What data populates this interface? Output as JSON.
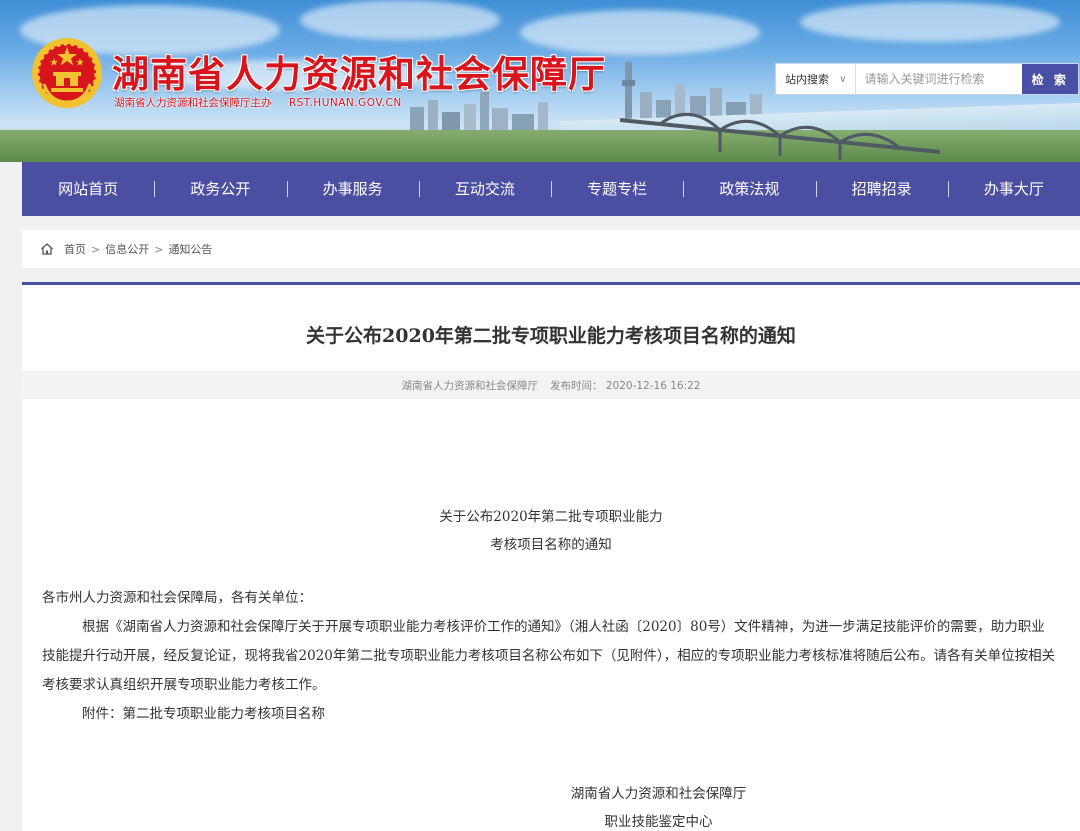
{
  "header": {
    "site_title": "湖南省人力资源和社会保障厅",
    "site_sub": "湖南省人力资源和社会保障厅主办",
    "site_url": "RST.HUNAN.GOV.CN"
  },
  "search": {
    "scope": "站内搜索",
    "placeholder": "请输入关键词进行检索",
    "button": "检 索"
  },
  "nav": {
    "items": [
      "网站首页",
      "政务公开",
      "办事服务",
      "互动交流",
      "专题专栏",
      "政策法规",
      "招聘招录",
      "办事大厅"
    ]
  },
  "breadcrumb": {
    "items": [
      "首页",
      "信息公开",
      "通知公告"
    ]
  },
  "article": {
    "title": "关于公布2020年第二批专项职业能力考核项目名称的通知",
    "source": "湖南省人力资源和社会保障厅",
    "publish_label": "发布时间：",
    "publish_time": "2020-12-16 16:22",
    "doc_title_line1": "关于公布2020年第二批专项职业能力",
    "doc_title_line2": "考核项目名称的通知",
    "salutation": "各市州人力资源和社会保障局，各有关单位：",
    "body": "根据《湖南省人力资源和社会保障厅关于开展专项职业能力考核评价工作的通知》（湘人社函〔2020〕80号）文件精神，为进一步满足技能评价的需要，助力职业技能提升行动开展，经反复论证，现将我省2020年第二批专项职业能力考核项目名称公布如下（见附件），相应的专项职业能力考核标准将随后公布。请各有关单位按相关考核要求认真组织开展专项职业能力考核工作。",
    "attachment": "附件：第二批专项职业能力考核项目名称",
    "signature_line1": "湖南省人力资源和社会保障厅",
    "signature_line2": "职业技能鉴定中心"
  },
  "colors": {
    "title_red": "#d8141c",
    "nav_purple": "#4b4fa2",
    "emblem_gold": "#f2c230"
  },
  "icons": [
    "national-emblem-icon",
    "home-icon",
    "chevron-down-icon"
  ]
}
